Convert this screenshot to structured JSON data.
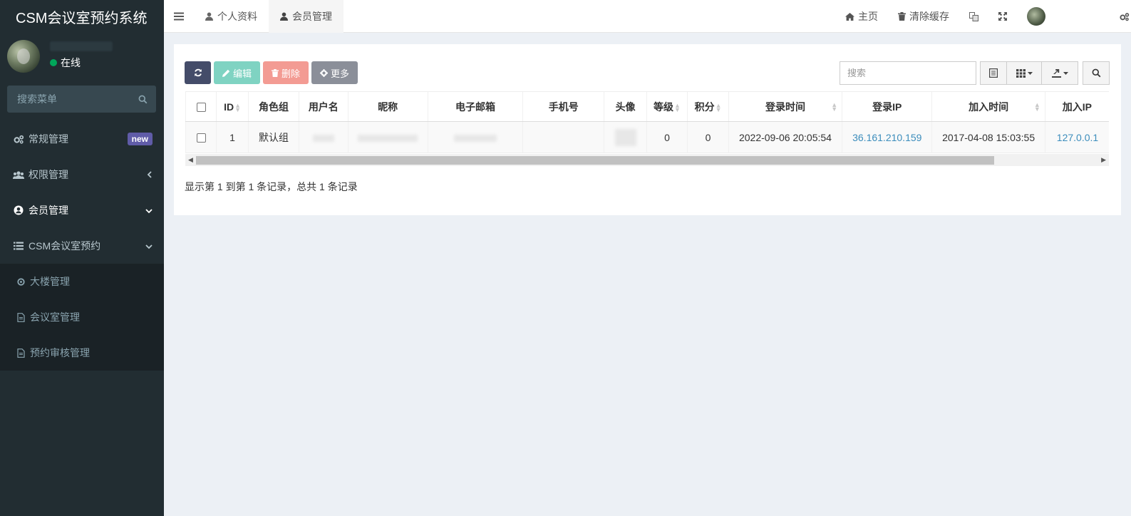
{
  "app": {
    "title": "CSM会议室预约系统"
  },
  "user_panel": {
    "status": "在线"
  },
  "sidebar_search": {
    "placeholder": "搜索菜单"
  },
  "menu": [
    {
      "label": "常规管理",
      "badge": "new",
      "icon": "cogs-icon"
    },
    {
      "label": "权限管理",
      "icon": "group-icon"
    },
    {
      "label": "会员管理",
      "icon": "user-circle-icon"
    },
    {
      "label": "CSM会议室预约",
      "icon": "list-icon"
    }
  ],
  "submenu": [
    {
      "label": "大楼管理",
      "icon": "circle-icon"
    },
    {
      "label": "会议室管理",
      "icon": "file-icon"
    },
    {
      "label": "预约审核管理",
      "icon": "file-icon"
    }
  ],
  "tabs": [
    {
      "label": "个人资料"
    },
    {
      "label": "会员管理"
    }
  ],
  "topbar_right": {
    "home": "主页",
    "clear_cache": "清除缓存"
  },
  "toolbar": {
    "edit": "编辑",
    "delete": "删除",
    "more": "更多"
  },
  "search": {
    "placeholder": "搜索"
  },
  "table": {
    "columns": [
      "ID",
      "角色组",
      "用户名",
      "昵称",
      "电子邮箱",
      "手机号",
      "头像",
      "等级",
      "积分",
      "登录时间",
      "登录IP",
      "加入时间",
      "加入IP"
    ],
    "rows": [
      {
        "id": "1",
        "group": "默认组",
        "level": "0",
        "score": "0",
        "login_time": "2022-09-06 20:05:54",
        "login_ip": "36.161.210.159",
        "join_time": "2017-04-08 15:03:55",
        "join_ip": "127.0.0.1"
      }
    ]
  },
  "pagination": {
    "info": "显示第 1 到第 1 条记录，总共 1 条记录"
  },
  "colors": {
    "sidebar_bg": "#222d32",
    "accent_new": "#605ca8",
    "online": "#00a65a",
    "link": "#3c8dbc"
  }
}
